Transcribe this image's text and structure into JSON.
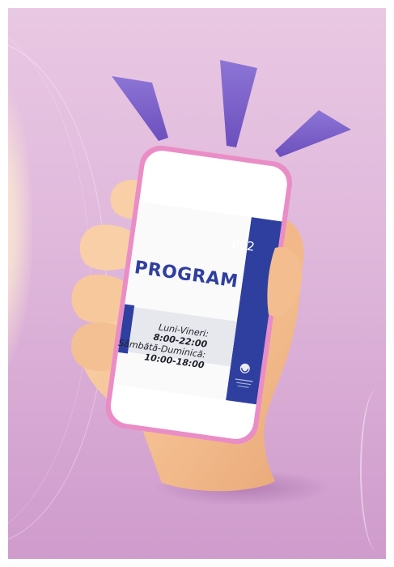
{
  "screen": {
    "title": "PROGRAM",
    "code": "P02",
    "hours": [
      {
        "days": "Luni-Vineri:",
        "time": "8:00-22:00"
      },
      {
        "days": "Sâmbătă-Duminică:",
        "time": "10:00-18:00"
      }
    ]
  },
  "colors": {
    "background": "#e0b8dc",
    "phone_frame": "#e88cc4",
    "screen_accent": "#2f3fa0",
    "sparks": "#7f63c9",
    "hand": "#f6c79c"
  },
  "icons": {
    "sparks": "attention-sparks-icon",
    "logo": "institution-logo-icon"
  }
}
